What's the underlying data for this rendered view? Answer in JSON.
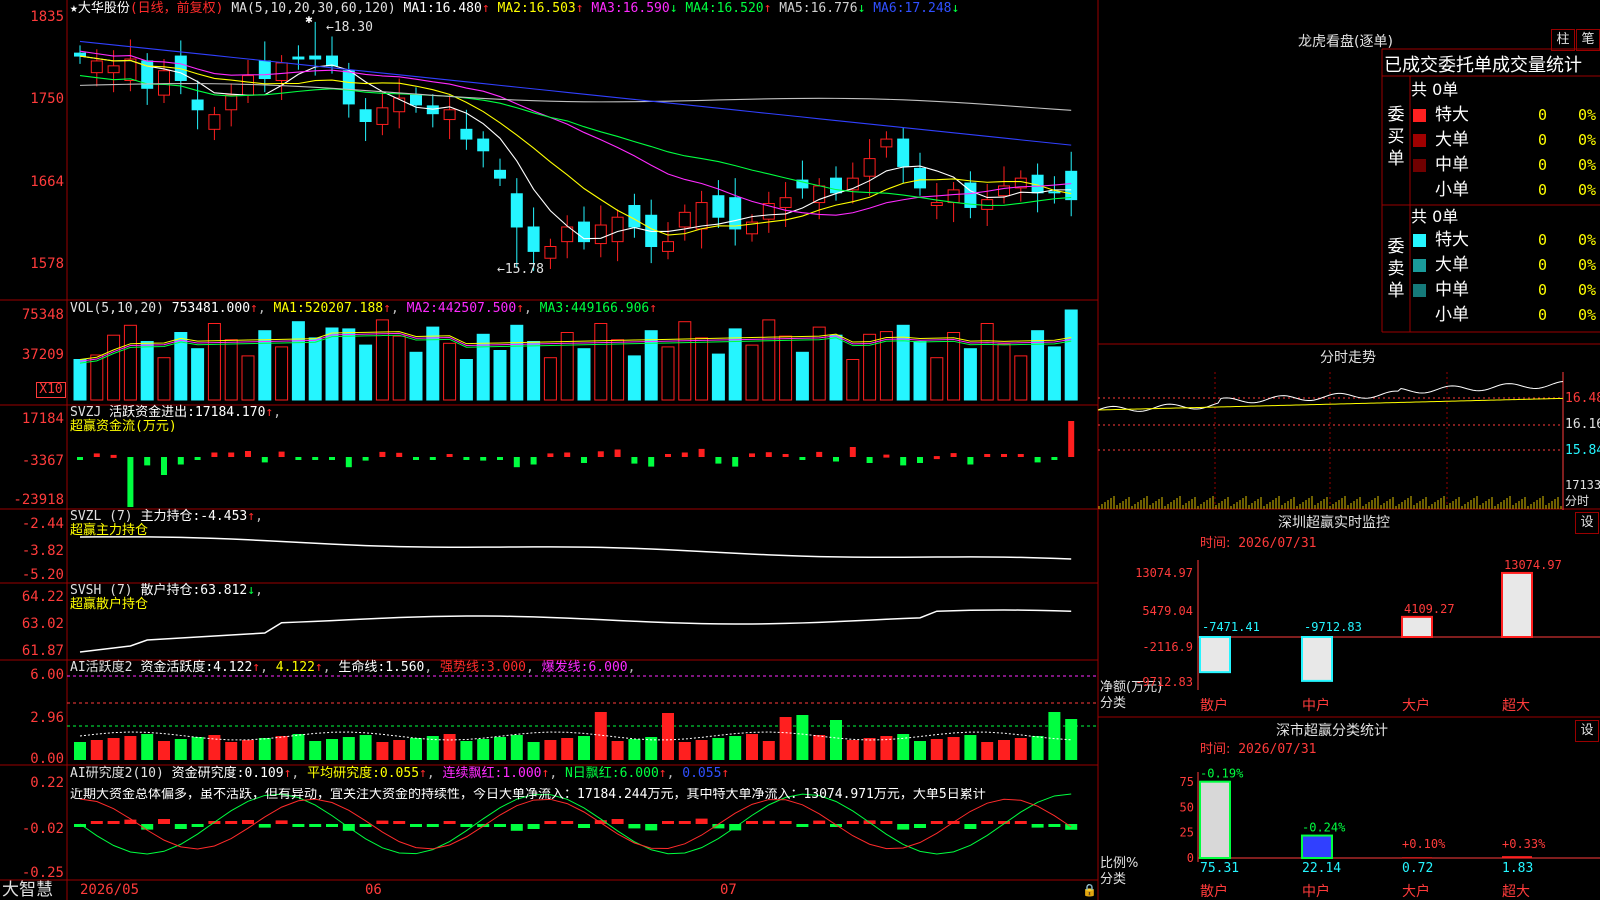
{
  "colors": {
    "up": "#ff1f1f",
    "down": "#25f5ff",
    "grid": "#9a0000",
    "axis": "#ff3b3b",
    "ma1": "#ffffff",
    "ma2": "#ffff00",
    "ma3": "#ff2bff",
    "ma4": "#00ff40",
    "ma5": "#c0c0c0",
    "ma6": "#3040ff"
  },
  "main": {
    "stock_name": "大华股份",
    "period": "(日线，前复权)",
    "ma_title": "MA(5,10,20,30,60,120)",
    "ma1_label": "MA1:",
    "ma1": "16.480",
    "ma1_arrow": "↑",
    "ma2_label": "MA2:",
    "ma2": "16.503",
    "ma2_arrow": "↑",
    "ma3_label": "MA3:",
    "ma3": "16.590",
    "ma3_arrow": "↓",
    "ma4_label": "MA4:",
    "ma4": "16.520",
    "ma4_arrow": "↑",
    "ma5_label": "MA5:",
    "ma5": "16.776",
    "ma5_arrow": "↓",
    "ma6_label": "MA6:",
    "ma6": "17.248",
    "ma6_arrow": "↓",
    "y_ticks": [
      "1835",
      "1750",
      "1664",
      "1578"
    ],
    "high_label": "18.30",
    "low_label": "15.78"
  },
  "vol": {
    "title": "VOL(5,10,20)",
    "value": "753481.000",
    "ma1_label": "MA1:",
    "ma1": "520207.188",
    "ma2_label": "MA2:",
    "ma2": "442507.500",
    "ma3_label": "MA3:",
    "ma3": "449166.906",
    "y_ticks": [
      "75348",
      "37209"
    ],
    "unit": "X10"
  },
  "svzj": {
    "title": "SVZJ",
    "label": "活跃资金进出:",
    "value": "17184.170",
    "arrow": "↑",
    ",": ",",
    "subtitle": "超赢资金流(万元)",
    "y_ticks": [
      "17184",
      "-3367",
      "-23918"
    ]
  },
  "svzl": {
    "title": "SVZL (7)",
    "label": "主力持仓:",
    "value": "-4.453",
    "arrow": "↑",
    "subtitle": "超赢主力持仓",
    "y_ticks": [
      "-2.44",
      "-3.82",
      "-5.20"
    ]
  },
  "svsh": {
    "title": "SVSH (7)",
    "label": "散户持仓:",
    "value": "63.812",
    "arrow": "↓",
    "subtitle": "超赢散户持仓",
    "y_ticks": [
      "64.22",
      "63.02",
      "61.87"
    ]
  },
  "ai2": {
    "title": "AI活跃度2",
    "label": "资金活跃度:",
    "value": "4.122",
    "value2": "4.122",
    "life_label": "生命线:",
    "life": "1.560",
    "strong_label": "强势线:",
    "strong": "3.000",
    "burst_label": "爆发线:",
    "burst": "6.000",
    "y_ticks": [
      "6.00",
      "2.96",
      "0.00"
    ]
  },
  "ai3": {
    "title": "AI研究度2(10)",
    "label": "资金研究度:",
    "value": "0.109",
    "avg_label": "平均研究度:",
    "avg": "0.055",
    "red_label": "连续飘红:",
    "red": "1.000",
    "nred_label": "N日飘红:",
    "nred": "6.000",
    "extra": "0.055",
    "comment": "近期大资金总体偏多，虽不活跃，但有异动，宜关注大资金的持续性，今日大单净流入：17184.244万元，其中特大单净流入：13074.971万元，大单5日累计",
    "y_ticks": [
      "0.22",
      "-0.02",
      "-0.25"
    ]
  },
  "xaxis": {
    "brand": "大智慧",
    "labels": [
      "2026/05",
      "06",
      "07"
    ]
  },
  "right": {
    "title": "龙虎看盘(逐单)",
    "btn_bar": "柱",
    "btn_pen": "笔",
    "stats_title": "已成交委托单成交量统计",
    "buy_side": "委买单",
    "sell_side": "委卖单",
    "buy_total": "共 0单",
    "sell_total": "共 0单",
    "buy_rows": [
      {
        "label": "特大",
        "count": "0",
        "pct": "0%",
        "color": "#ff2020"
      },
      {
        "label": "大单",
        "count": "0",
        "pct": "0%",
        "color": "#a00000"
      },
      {
        "label": "中单",
        "count": "0",
        "pct": "0%",
        "color": "#700000"
      },
      {
        "label": "小单",
        "count": "0",
        "pct": "0%",
        "color": "#000000"
      }
    ],
    "sell_rows": [
      {
        "label": "特大",
        "count": "0",
        "pct": "0%",
        "color": "#25f5ff"
      },
      {
        "label": "大单",
        "count": "0",
        "pct": "0%",
        "color": "#1a9b9b"
      },
      {
        "label": "中单",
        "count": "0",
        "pct": "0%",
        "color": "#157a7a"
      },
      {
        "label": "小单",
        "count": "0",
        "pct": "0%",
        "color": "#000000"
      }
    ],
    "intraday_title": "分时走势",
    "intraday_ticks": [
      "16.48",
      "16.16",
      "15.84"
    ],
    "intraday_vol": "17133",
    "intraday_unit": "分时",
    "monitor_title": "深圳超赢实时监控",
    "monitor_btn": "设",
    "monitor_time_label": "时间:",
    "monitor_time": "2026/07/31",
    "monitor_y": [
      "13074.97",
      "5479.04",
      "-2116.9",
      "-9712.83"
    ],
    "monitor_bars": [
      {
        "label": "散户",
        "value": -7471.41,
        "text": "-7471.41"
      },
      {
        "label": "中户",
        "value": -9712.83,
        "text": "-9712.83"
      },
      {
        "label": "大户",
        "value": 4109.27,
        "text": "4109.27"
      },
      {
        "label": "超大",
        "value": 13074.97,
        "text": "13074.97"
      }
    ],
    "monitor_axis1": "净额(万元)",
    "monitor_axis2": "分类",
    "class_title": "深市超赢分类统计",
    "class_btn": "设",
    "class_time_label": "时间:",
    "class_time": "2026/07/31",
    "class_y": [
      "75",
      "50",
      "25",
      "0"
    ],
    "class_bars": [
      {
        "label": "散户",
        "value": 75.31,
        "text": "75.31",
        "change": "-0.19%"
      },
      {
        "label": "中户",
        "value": 22.14,
        "text": "22.14",
        "change": "-0.24%"
      },
      {
        "label": "大户",
        "value": 0.72,
        "text": "0.72",
        "change": "+0.10%"
      },
      {
        "label": "超大",
        "value": 1.83,
        "text": "1.83",
        "change": "+0.33%"
      }
    ],
    "class_axis1": "比例%",
    "class_axis2": "分类"
  }
}
